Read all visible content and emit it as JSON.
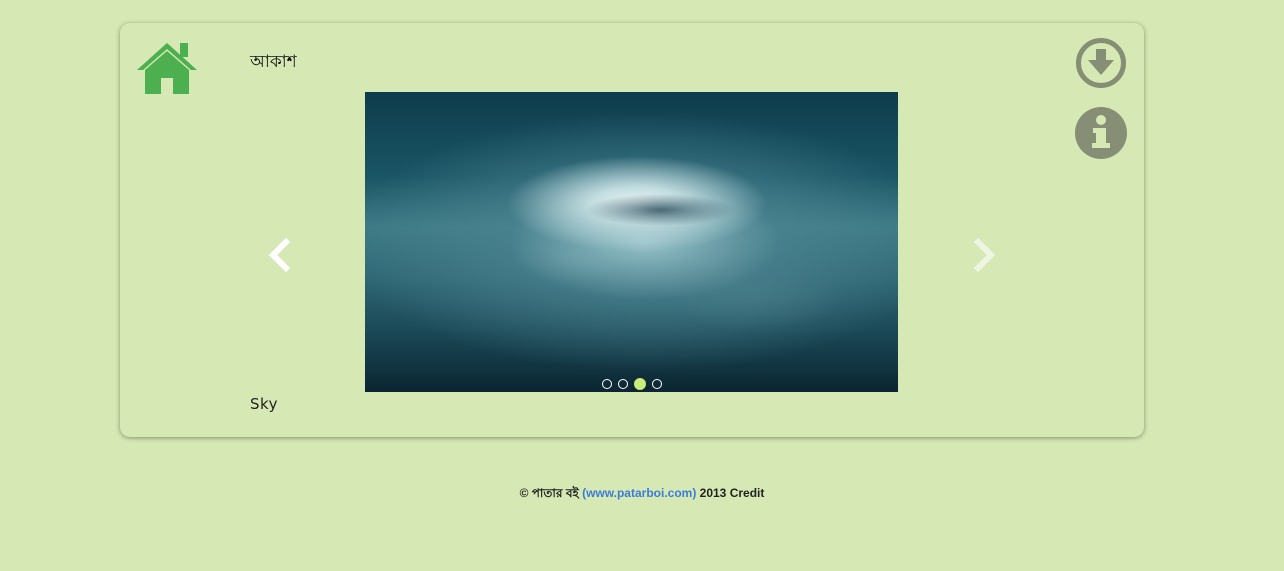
{
  "header": {
    "title": "আকাশ",
    "home_icon": "home-icon"
  },
  "slideshow": {
    "caption": "Sky",
    "dots": [
      {
        "label": "",
        "active": false
      },
      {
        "label": "",
        "active": false
      },
      {
        "label": "",
        "active": true
      },
      {
        "label": "",
        "active": false
      }
    ],
    "prev_icon": "chevron-left-icon",
    "next_icon": "chevron-right-icon"
  },
  "actions": {
    "download_icon": "download-icon",
    "info_icon": "info-icon"
  },
  "footer": {
    "prefix": "© পাতার বই ",
    "link": "(www.patarboi.com)",
    "suffix": " 2013 Credit"
  },
  "colors": {
    "background": "#d6e8b3",
    "home_icon": "#4caf50",
    "action_icons": "#868e76",
    "active_dot": "#c9ee7a",
    "footer_link": "#3b7dd8"
  }
}
